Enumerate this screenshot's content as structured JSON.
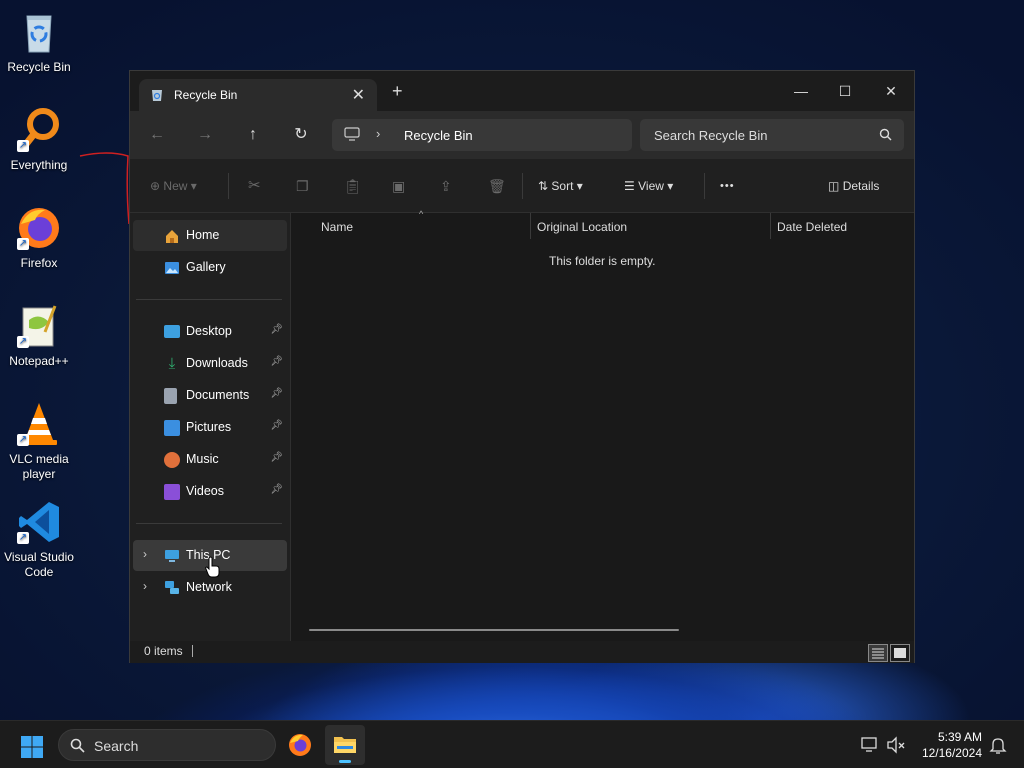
{
  "desktop": {
    "icons": [
      {
        "label": "Recycle Bin",
        "icon": "recycle-bin-icon"
      },
      {
        "label": "Everything",
        "icon": "everything-search-icon"
      },
      {
        "label": "Firefox",
        "icon": "firefox-icon"
      },
      {
        "label": "Notepad++",
        "icon": "notepad-plus-plus-icon"
      },
      {
        "label": "VLC media player",
        "icon": "vlc-icon"
      },
      {
        "label": "Visual Studio Code",
        "icon": "vscode-icon"
      }
    ]
  },
  "explorer": {
    "tab_title": "Recycle Bin",
    "address": {
      "crumb": "Recycle Bin"
    },
    "search": {
      "placeholder": "Search Recycle Bin"
    },
    "commands": {
      "new": "New",
      "sort": "Sort",
      "view": "View",
      "more": "•••",
      "details": "Details"
    },
    "sidebar": {
      "home": "Home",
      "gallery": "Gallery",
      "quick_access": [
        {
          "label": "Desktop",
          "icon": "desktop-folder-icon",
          "color": "#3da0e0"
        },
        {
          "label": "Downloads",
          "icon": "downloads-folder-icon",
          "color": "#2fae6f"
        },
        {
          "label": "Documents",
          "icon": "documents-folder-icon",
          "color": "#9aa3b0"
        },
        {
          "label": "Pictures",
          "icon": "pictures-folder-icon",
          "color": "#3b8fe0"
        },
        {
          "label": "Music",
          "icon": "music-folder-icon",
          "color": "#e0703b"
        },
        {
          "label": "Videos",
          "icon": "videos-folder-icon",
          "color": "#8a4fd8"
        }
      ],
      "this_pc": "This PC",
      "network": "Network"
    },
    "columns": {
      "name": "Name",
      "original_location": "Original Location",
      "date_deleted": "Date Deleted"
    },
    "empty_message": "This folder is empty.",
    "status": {
      "items": "0 items"
    }
  },
  "taskbar": {
    "search_label": "Search",
    "time": "5:39 AM",
    "date": "12/16/2024"
  },
  "colors": {
    "accent": "#4cc2ff",
    "window_bg": "#202020",
    "content_bg": "#191919"
  }
}
